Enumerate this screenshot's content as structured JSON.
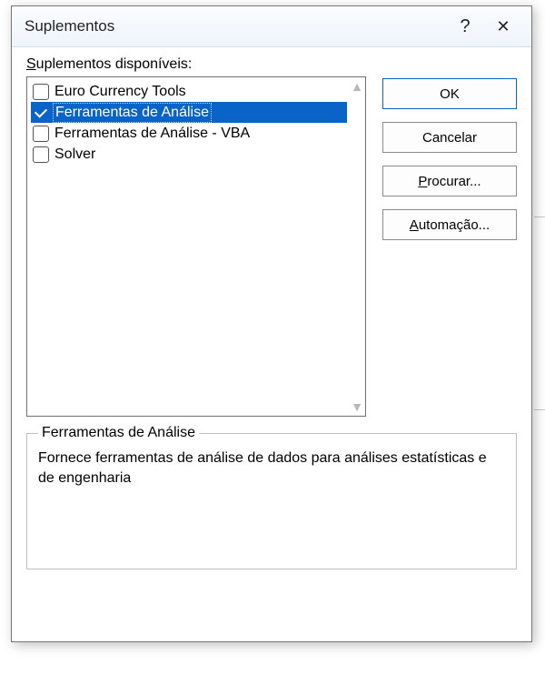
{
  "dialog": {
    "title": "Suplementos",
    "help_tooltip": "?",
    "close_tooltip": "✕"
  },
  "list_label_pre": "S",
  "list_label_rest": "uplementos disponíveis:",
  "items": [
    {
      "label": "Euro Currency Tools",
      "checked": false,
      "selected": false
    },
    {
      "label": "Ferramentas de Análise",
      "checked": true,
      "selected": true
    },
    {
      "label": "Ferramentas de Análise - VBA",
      "checked": false,
      "selected": false
    },
    {
      "label": "Solver",
      "checked": false,
      "selected": false
    }
  ],
  "buttons": {
    "ok": "OK",
    "cancel": "Cancelar",
    "browse_pre": "P",
    "browse_rest": "rocurar...",
    "auto_pre": "A",
    "auto_rest": "utomação..."
  },
  "details": {
    "title": "Ferramentas de Análise",
    "description": "Fornece ferramentas de análise de dados para análises estatísticas e de engenharia"
  }
}
